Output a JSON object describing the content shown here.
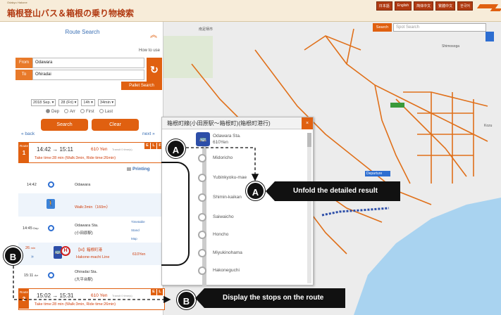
{
  "header": {
    "brand_small": "Odakyu Hakone",
    "logo": "箱根登山バス＆箱根の乗り物検索",
    "lang_buttons": [
      "日本語",
      "English",
      "简体中文",
      "繁體中文",
      "한국어"
    ]
  },
  "search_panel": {
    "title": "Route Search",
    "how_to_use": "How to use",
    "from_label": "From",
    "from_value": "Odawara",
    "to_label": "To",
    "to_value": "Ohiradai",
    "pallet_search": "Pallet Search",
    "date_selects": [
      "2018 Sep.",
      "28 (Fri)",
      "14h",
      "34min"
    ],
    "time_options": [
      {
        "label": "Dep",
        "selected": true
      },
      {
        "label": "Arr",
        "selected": false
      },
      {
        "label": "First",
        "selected": false
      },
      {
        "label": "Last",
        "selected": false
      }
    ],
    "search_button": "Search",
    "clear_button": "Clear",
    "back_link": "« back",
    "next_link": "next »"
  },
  "routes": [
    {
      "tag": "Route",
      "number": "1",
      "time": "14:42 → 15:11",
      "fare": "610 Yen",
      "misc": "Transit 0 time(s)",
      "flags": [
        "E",
        "L",
        "F"
      ],
      "sub": "Take time:28 min (Walk:3min, Ride time:26min)"
    },
    {
      "tag": "Route",
      "number": "2",
      "time": "15:02 → 15:31",
      "fare": "610 Yen",
      "misc": "Transit 0 time(s)",
      "flags": [
        "E",
        "L"
      ],
      "sub": "Take time:28 min (Walk:3min, Ride time:26min)"
    }
  ],
  "printing": "Printing",
  "detail": {
    "start_time": "14:42",
    "start_name": "Odawara",
    "walk": "Walk:3min（160m）",
    "board_time": "14:45",
    "board_tag": "Dep",
    "board_name": "Odawara Sta.",
    "board_name_jp": "(小田原駅)",
    "side_links": [
      "Timetable",
      "Stand",
      "Map"
    ],
    "ride_min": "26",
    "ride_unit": "min",
    "line_name_jp": "【H】箱根町港",
    "line_name": "Hakone-machi Line",
    "line_fare": "610Yen",
    "arr_time": "15:11",
    "arr_tag": "Arr",
    "arr_name": "Ohiradai Sta.",
    "arr_name_jp": "(大平台駅)"
  },
  "map": {
    "search_button": "Search",
    "search_placeholder": "Spot Search",
    "places": [
      "南足柄市",
      "Shimosoga",
      "Kozu",
      "Departure"
    ]
  },
  "popup": {
    "title": "箱根町線(小田原駅〜箱根町)(箱根町港行)",
    "close": "×",
    "first_stop": "Odawara Sta.",
    "first_fare": "610Yen",
    "stops": [
      "Midoricho",
      "Yubinkyoku-mae",
      "Shimin-kaikan",
      "Saiwaicho",
      "Honcho",
      "Miyukinohama",
      "Hakoneguchi"
    ]
  },
  "annotations": {
    "badge_a": "A",
    "badge_b": "B",
    "callout_a": "Unfold the detailed result",
    "callout_b": "Display the stops on the route"
  },
  "colors": {
    "accent": "#e06010",
    "link": "#3a6fb4",
    "bus": "#2d4ea8"
  }
}
